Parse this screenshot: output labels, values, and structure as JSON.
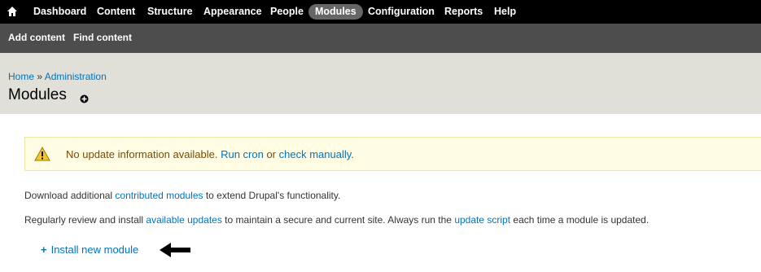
{
  "toolbar": {
    "home_icon": "home-icon",
    "items": [
      {
        "label": "Dashboard",
        "active": false
      },
      {
        "label": "Content",
        "active": false
      },
      {
        "label": "Structure",
        "active": false
      },
      {
        "label": "Appearance",
        "active": false
      },
      {
        "label": "People",
        "active": false
      },
      {
        "label": "Modules",
        "active": true
      },
      {
        "label": "Configuration",
        "active": false
      },
      {
        "label": "Reports",
        "active": false
      },
      {
        "label": "Help",
        "active": false
      }
    ]
  },
  "shortcuts": {
    "items": [
      {
        "label": "Add content"
      },
      {
        "label": "Find content"
      }
    ]
  },
  "header": {
    "breadcrumb": {
      "home": "Home",
      "separator": "»",
      "admin": "Administration"
    },
    "title": "Modules",
    "shortcut_icon": "add-shortcut-icon"
  },
  "warning": {
    "icon": "warning-icon",
    "text_before": "No update information available.",
    "link1": "Run cron",
    "text_or": "or",
    "link2": "check manually",
    "text_end": "."
  },
  "help": {
    "line1_before": "Download additional",
    "line1_link": "contributed modules",
    "line1_after": "to extend Drupal's functionality.",
    "line2_before": "Regularly review and install",
    "line2_link1": "available updates",
    "line2_mid": "to maintain a secure and current site. Always run the",
    "line2_link2": "update script",
    "line2_after": "each time a module is updated."
  },
  "action": {
    "plus": "+",
    "label": "Install new module",
    "arrow_icon": "arrow-left-icon"
  },
  "colors": {
    "toolbar_bg": "#000000",
    "shortcuts_bg": "#4d4d4d",
    "header_bg": "#e0e0d8",
    "link": "#0074bd",
    "warning_bg": "#fffce3",
    "warning_text": "#7a4b00"
  }
}
